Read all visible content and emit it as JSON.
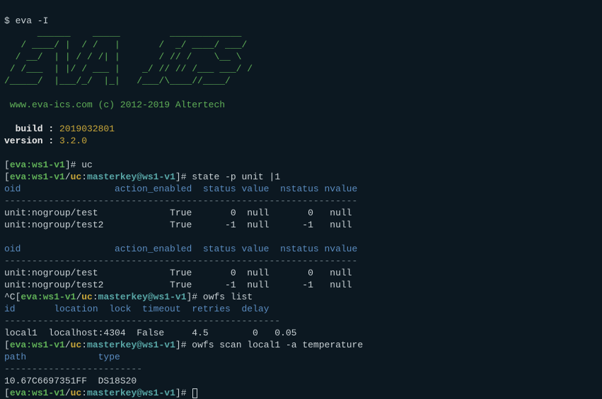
{
  "cmd0": "$ eva -I",
  "ascii": {
    "l1": "      ______    _____         _____________",
    "l2": "   / ____/ |  / /   |       /  _/ ____/ ___/",
    "l3": "  / __/  | | / / /| |       / // /    \\__ \\",
    "l4": " / /___  | |/ / ___ |    _/ // // /___ ___/ /",
    "l5": "/_____/  |___/_/  |_|   /___/\\____//____/"
  },
  "footer": " www.eva-ics.com (c) 2012-2019 Altertech",
  "build": {
    "label": "  build : ",
    "value": "2019032801"
  },
  "version": {
    "label": "version : ",
    "value": "3.2.0"
  },
  "ps1_short": {
    "lb": "[",
    "host": "eva:ws1-v1",
    "rb": "]# "
  },
  "ps1_full": {
    "lb": "[",
    "host": "eva:ws1-v1",
    "slash": "/",
    "svc": "uc",
    "colon": ":",
    "key": "masterkey@ws1-v1",
    "rb": "]# "
  },
  "cmds": {
    "uc": "uc",
    "state": "state -p unit |1",
    "owfs_list": "owfs list",
    "owfs_scan": "owfs scan local1 -a temperature"
  },
  "caretC": "^C",
  "unit_hdr": "oid                 action_enabled  status value  nstatus nvalue",
  "dash64": "----------------------------------------------------------------",
  "unit_rows": [
    "unit:nogroup/test             True       0  null       0   null",
    "unit:nogroup/test2            True      -1  null      -1   null"
  ],
  "owfs_list_hdr": "id       location  lock  timeout  retries  delay",
  "dash50": "--------------------------------------------------",
  "owfs_list_row": "local1  localhost:4304  False     4.5        0   0.05",
  "owfs_scan_hdr": "path             type",
  "dash25": "-------------------------",
  "owfs_scan_row": "10.67C6697351FF  DS18S20"
}
